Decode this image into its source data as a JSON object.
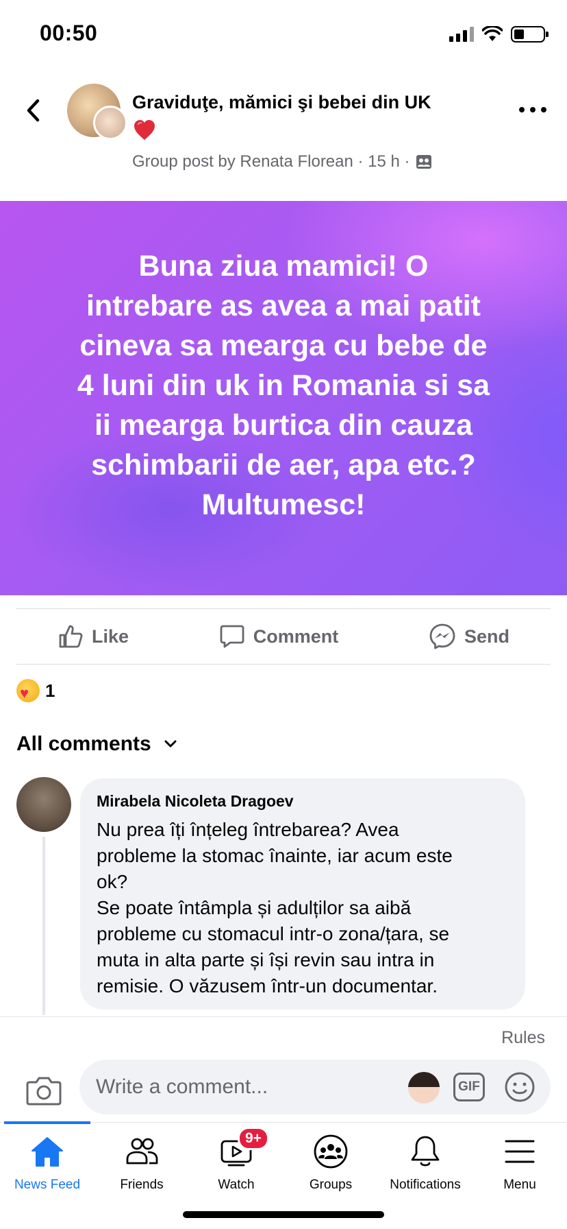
{
  "status_bar": {
    "time": "00:50"
  },
  "header": {
    "group_name": "Graviduţe, mămici şi bebei din UK",
    "post_meta": "Group post by Renata Florean · 15 h ·"
  },
  "post": {
    "text": "Buna ziua mamici! O\nintrebare as avea a mai patit\ncineva sa mearga cu bebe de\n4 luni din uk in Romania si sa\nii mearga burtica din cauza\nschimbarii de aer, apa etc.?\nMultumesc!",
    "background_colors": [
      "#b855f0",
      "#8e5cf5"
    ]
  },
  "actions": {
    "like": "Like",
    "comment": "Comment",
    "send": "Send"
  },
  "reactions": {
    "count": "1",
    "icon": "care-reaction-icon"
  },
  "comments_filter": {
    "label": "All comments"
  },
  "comment": {
    "author": "Mirabela Nicoleta Dragoev",
    "text": "Nu prea îți înțeleg întrebarea? Avea\nprobleme la stomac înainte, iar acum este\nok?\nSe poate întâmpla și adulților sa aibă\nprobleme cu stomacul intr-o zona/țara, se\nmuta in alta parte și își revin sau intra in\nremisie. O văzusem într-un documentar."
  },
  "composer": {
    "rules": "Rules",
    "placeholder": "Write a comment...",
    "gif_label": "GIF"
  },
  "tabbar": {
    "tabs": [
      {
        "label": "News Feed",
        "icon": "home-icon",
        "active": true
      },
      {
        "label": "Friends",
        "icon": "friends-icon"
      },
      {
        "label": "Watch",
        "icon": "watch-icon",
        "badge": "9+"
      },
      {
        "label": "Groups",
        "icon": "groups-icon"
      },
      {
        "label": "Notifications",
        "icon": "bell-icon"
      },
      {
        "label": "Menu",
        "icon": "menu-icon"
      }
    ]
  },
  "colors": {
    "accent": "#1877f2",
    "secondary_text": "#65676b",
    "badge": "#e41e3f"
  }
}
